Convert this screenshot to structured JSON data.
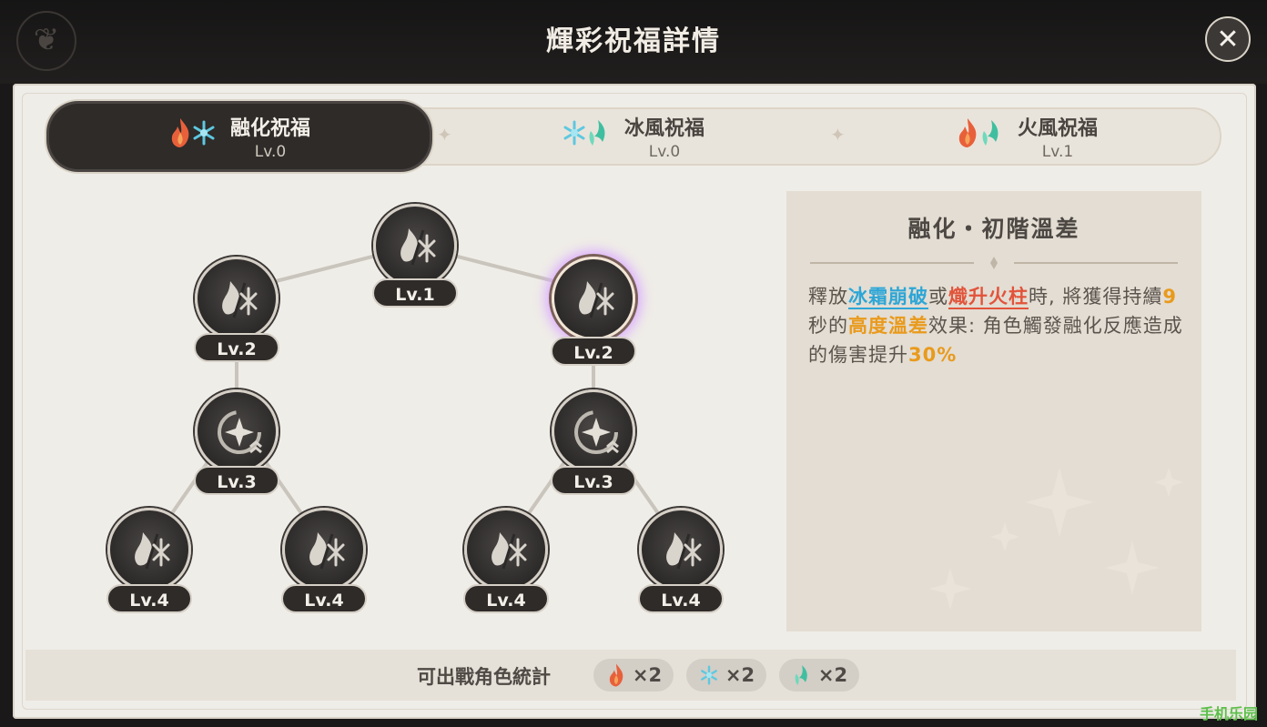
{
  "window": {
    "title": "輝彩祝福詳情",
    "close_icon": "close-icon"
  },
  "tabs": [
    {
      "name": "融化祝福",
      "level": "Lv.0",
      "icons": [
        "pyro-icon",
        "cryo-icon"
      ],
      "active": true
    },
    {
      "name": "冰風祝福",
      "level": "Lv.0",
      "icons": [
        "cryo-icon",
        "anemo-icon"
      ],
      "active": false
    },
    {
      "name": "火風祝福",
      "level": "Lv.1",
      "icons": [
        "pyro-icon",
        "anemo-icon"
      ],
      "active": false
    }
  ],
  "tree": {
    "nodes": [
      {
        "id": "root",
        "level": "Lv.1",
        "icon": "melt-emblem-icon"
      },
      {
        "id": "left-2",
        "level": "Lv.2",
        "icon": "melt-ring-icon"
      },
      {
        "id": "right-2",
        "level": "Lv.2",
        "icon": "melt-sparkle-icon",
        "selected": true
      },
      {
        "id": "left-3",
        "level": "Lv.3",
        "icon": "upgrade-star-icon"
      },
      {
        "id": "right-3",
        "level": "Lv.3",
        "icon": "upgrade-star-icon"
      },
      {
        "id": "left-4a",
        "level": "Lv.4",
        "icon": "melt-ring-i-icon"
      },
      {
        "id": "left-4b",
        "level": "Lv.4",
        "icon": "melt-ring-ii-icon"
      },
      {
        "id": "right-4a",
        "level": "Lv.4",
        "icon": "melt-sparkle-i-icon"
      },
      {
        "id": "right-4b",
        "level": "Lv.4",
        "icon": "melt-sparkle-ii-icon"
      }
    ]
  },
  "detail": {
    "title": "融化・初階溫差",
    "text": {
      "p1": "釋放",
      "skill1": "冰霜崩破",
      "p2": "或",
      "skill2": "熾升火柱",
      "p3": "時, 將獲得持續",
      "duration": "9",
      "p4": "秒的",
      "effect": "高度溫差",
      "p5": "效果: 角色觸發融化反應造成的傷害提升",
      "bonus": "30%"
    }
  },
  "stats": {
    "label": "可出戰角色統計",
    "chips": [
      {
        "icon": "pyro-icon",
        "count": "×2"
      },
      {
        "icon": "cryo-icon",
        "count": "×2"
      },
      {
        "icon": "anemo-icon",
        "count": "×2"
      }
    ]
  },
  "watermark": "手机乐园",
  "colors": {
    "pyro": "#e8603a",
    "cryo": "#5ec8e0",
    "anemo": "#3fbfa0",
    "highlight_blue": "#2da6d6",
    "highlight_red": "#e2533a",
    "highlight_orange": "#e99a1c"
  }
}
